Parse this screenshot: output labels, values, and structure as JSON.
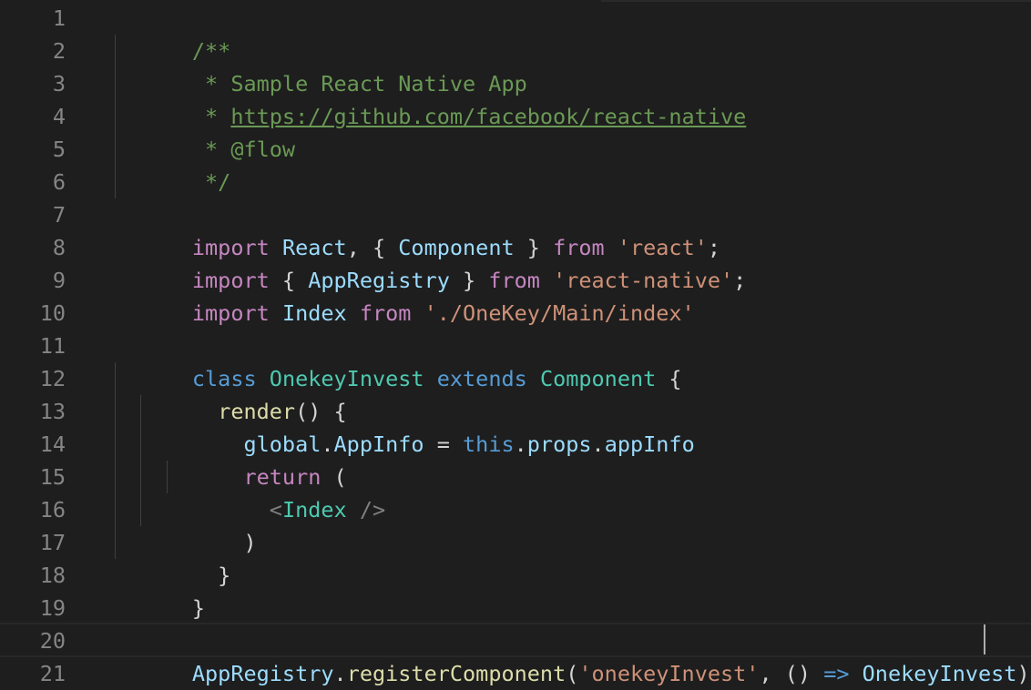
{
  "editor": {
    "line_numbers": [
      "1",
      "2",
      "3",
      "4",
      "5",
      "6",
      "7",
      "8",
      "9",
      "10",
      "11",
      "12",
      "13",
      "14",
      "15",
      "16",
      "17",
      "18",
      "19",
      "20",
      "21"
    ],
    "lines": {
      "l1": {
        "t1": "/**"
      },
      "l2": {
        "t1": " * Sample React Native App"
      },
      "l3": {
        "t1": " * ",
        "t2": "https://github.com/facebook/react-native"
      },
      "l4": {
        "t1": " * @flow"
      },
      "l5": {
        "t1": " */"
      },
      "l7": {
        "t1": "import",
        "t2": " ",
        "t3": "React",
        "t4": ", { ",
        "t5": "Component",
        "t6": " } ",
        "t7": "from",
        "t8": " ",
        "t9": "'react'",
        "t10": ";"
      },
      "l8": {
        "t1": "import",
        "t2": " { ",
        "t3": "AppRegistry",
        "t4": " } ",
        "t5": "from",
        "t6": " ",
        "t7": "'react-native'",
        "t8": ";"
      },
      "l9": {
        "t1": "import",
        "t2": " ",
        "t3": "Index",
        "t4": " ",
        "t5": "from",
        "t6": " ",
        "t7": "'./OneKey/Main/index'"
      },
      "l11": {
        "t1": "class",
        "t2": " ",
        "t3": "OnekeyInvest",
        "t4": " ",
        "t5": "extends",
        "t6": " ",
        "t7": "Component",
        "t8": " {"
      },
      "l12": {
        "t1": "  ",
        "t2": "render",
        "t3": "() {"
      },
      "l13": {
        "t1": "    ",
        "t2": "global",
        "t3": ".",
        "t4": "AppInfo",
        "t5": " = ",
        "t6": "this",
        "t7": ".",
        "t8": "props",
        "t9": ".",
        "t10": "appInfo"
      },
      "l14": {
        "t1": "    ",
        "t2": "return",
        "t3": " ("
      },
      "l15": {
        "t1": "      ",
        "t2": "<",
        "t3": "Index",
        "t4": " />"
      },
      "l16": {
        "t1": "    )"
      },
      "l17": {
        "t1": "  }"
      },
      "l18": {
        "t1": "}"
      },
      "l20": {
        "t1": "AppRegistry",
        "t2": ".",
        "t3": "registerComponent",
        "t4": "(",
        "t5": "'onekeyInvest'",
        "t6": ", () ",
        "t7": "=>",
        "t8": " ",
        "t9": "OnekeyInvest",
        "t10": ");"
      }
    }
  },
  "colors": {
    "background": "#1e1e1e",
    "line_number": "#858585",
    "comment": "#6a9955",
    "keyword": "#c586c0",
    "variable": "#9cdcfe",
    "string": "#ce9178",
    "storage": "#569cd6",
    "class": "#4ec9b0",
    "function": "#dcdcaa"
  }
}
